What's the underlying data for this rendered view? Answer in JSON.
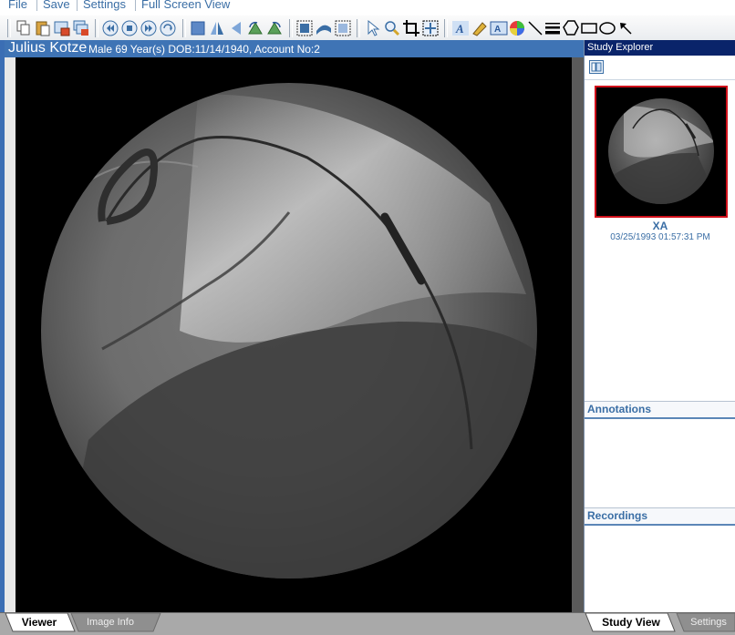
{
  "menu": {
    "items": [
      "File",
      "Save",
      "Settings",
      "Full Screen View"
    ]
  },
  "patient": {
    "name": "Julius Kotze",
    "info": "Male 69 Year(s) DOB:11/14/1940, Account No:2"
  },
  "study_explorer": {
    "title": "Study Explorer",
    "thumbnail": {
      "modality": "XA",
      "datetime": "03/25/1993 01:57:31 PM"
    },
    "annotations_label": "Annotations",
    "recordings_label": "Recordings"
  },
  "tabs": {
    "viewer": "Viewer",
    "image_info": "Image Info",
    "study_view": "Study View",
    "settings": "Settings"
  },
  "colors": {
    "header_blue": "#3f74b5",
    "explorer_header": "#0a246a",
    "accent_text": "#3a6ea5",
    "selection_red": "#d0101a"
  }
}
